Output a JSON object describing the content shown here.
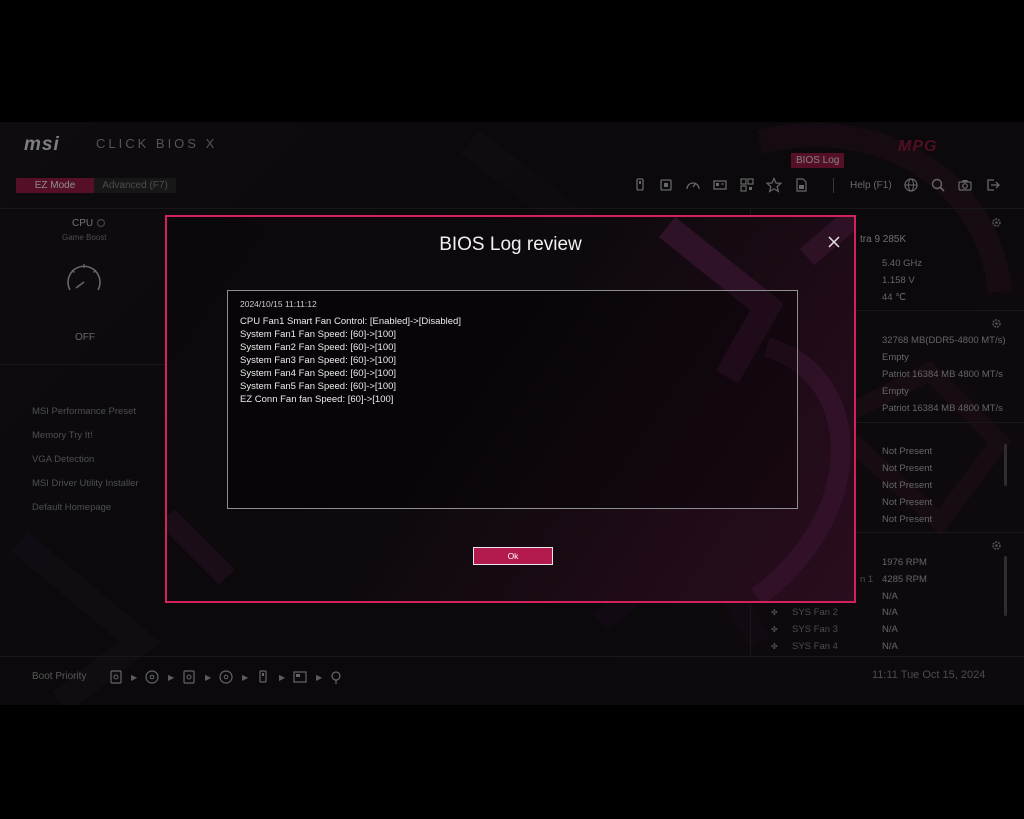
{
  "header": {
    "brand": "msi",
    "product": "CLICK BIOS X",
    "brand_right": "MPG",
    "bios_log_button": "BIOS Log",
    "ez_mode": "EZ Mode",
    "advanced_mode": "Advanced (F7)",
    "help": "Help (F1)"
  },
  "toolbar_icons": [
    "usb-icon",
    "cpu-icon",
    "gauge-icon",
    "memory-icon",
    "qr-icon",
    "favorite-icon",
    "file-icon",
    "globe-icon",
    "search-icon",
    "camera-icon",
    "exit-icon"
  ],
  "left": {
    "cpu_label": "CPU",
    "game_boost": "Game Boost",
    "state": "OFF",
    "menu": [
      "MSI Performance Preset",
      "Memory Try It!",
      "VGA Detection",
      "MSI Driver Utility Installer",
      "Default Homepage"
    ]
  },
  "right_panel": {
    "cpu_name_partial": "tra 9 285K",
    "cpu_values": [
      "5.40 GHz",
      "1.158 V",
      "44 ℃"
    ],
    "memory_values": [
      "32768 MB(DDR5-4800 MT/s)",
      "Empty",
      "Patriot 16384 MB 4800 MT/s",
      "Empty",
      "Patriot 16384 MB 4800 MT/s"
    ],
    "storage_values": [
      "Not Present",
      "Not Present",
      "Not Present",
      "Not Present",
      "Not Present"
    ],
    "fan_values": [
      "1976 RPM",
      "4285 RPM",
      "N/A",
      "N/A",
      "N/A",
      "N/A"
    ],
    "fan_partial_label": "n 1",
    "fan_labels": [
      "SYS Fan 2",
      "SYS Fan 3",
      "SYS Fan 4"
    ]
  },
  "bottom": {
    "boot_priority": "Boot Priority",
    "boot_devices": [
      "drive-icon",
      "disc-icon",
      "drive-icon",
      "disc-icon",
      "usb-icon",
      "card-icon",
      "network-icon"
    ],
    "clock": "11:11  Tue Oct 15, 2024"
  },
  "modal": {
    "title": "BIOS Log review",
    "date": "2024/10/15 11:11:12",
    "log_lines": [
      "CPU Fan1 Smart Fan Control: [Enabled]->[Disabled]",
      "System Fan1 Fan Speed: [60]->[100]",
      "System Fan2 Fan Speed: [60]->[100]",
      "System Fan3 Fan Speed: [60]->[100]",
      "System Fan4 Fan Speed: [60]->[100]",
      "System Fan5 Fan Speed: [60]->[100]",
      "EZ Conn Fan fan Speed: [60]->[100]"
    ],
    "ok_label": "Ok"
  },
  "colors": {
    "accent": "#d4215c",
    "accent_dark": "#9c1e47",
    "background": "#000000"
  }
}
